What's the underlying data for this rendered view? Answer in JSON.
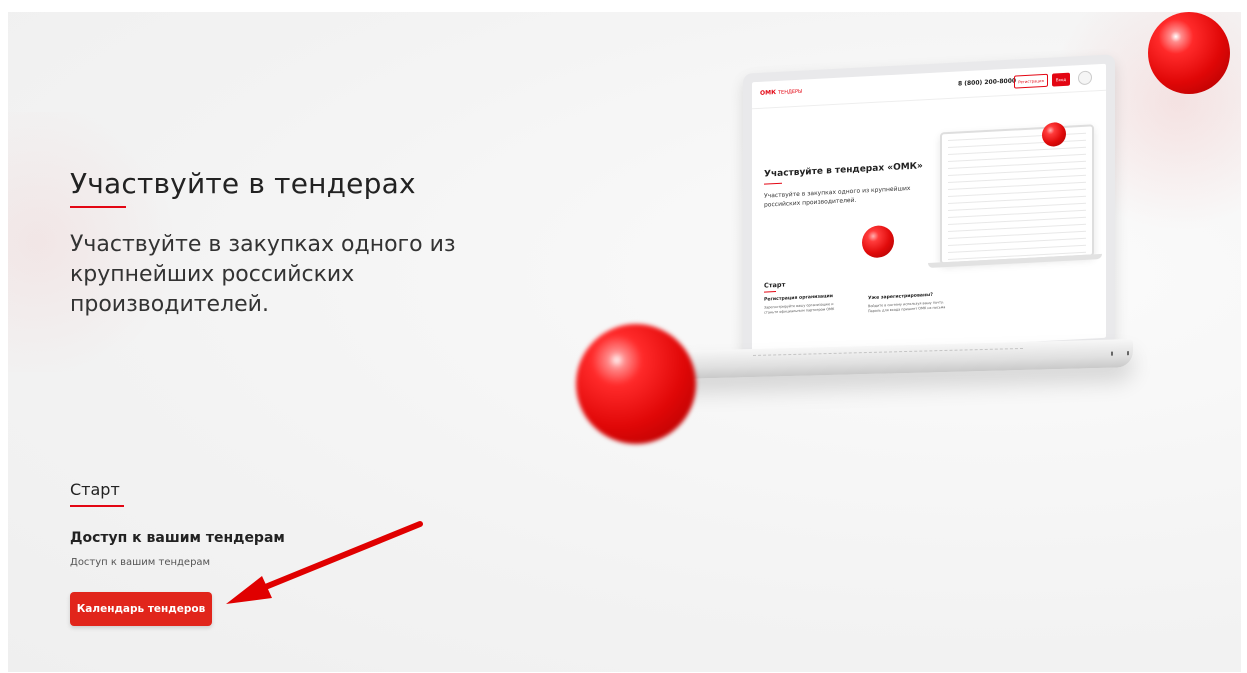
{
  "hero": {
    "title": "Участвуйте в тендерах",
    "subtitle": "Участвуйте в закупках одного из крупнейших российских производителей."
  },
  "start": {
    "heading": "Старт",
    "access_title": "Доступ к вашим тендерам",
    "access_desc": "Доступ к вашим тендерам",
    "calendar_button": "Календарь тендеров"
  },
  "laptop_screen": {
    "logo": "ОМК",
    "nav_label": "ТЕНДЕРЫ",
    "phone": "8 (800) 200-8000",
    "register_button": "Регистрация",
    "login_button": "Вход",
    "title": "Участвуйте в тендерах «ОМК»",
    "subtitle": "Участвуйте в закупках одного из крупнейших российских производителей.",
    "start_heading": "Старт",
    "registration_title": "Регистрация организации",
    "registration_desc": "Зарегистрируйте вашу организацию и станьте официальным партнером ОМК",
    "already_title": "Уже зарегистрированы?",
    "already_desc": "Войдите в систему используя вашу почту. Пароль для входа пришлет ОМК из письма"
  },
  "colors": {
    "accent": "#e1251b",
    "underline": "#e30613",
    "page_bg": "#f3f3f3",
    "annotation_arrow": "#e00000"
  },
  "annotation": {
    "type": "arrow",
    "points_to": "calendar-button"
  }
}
